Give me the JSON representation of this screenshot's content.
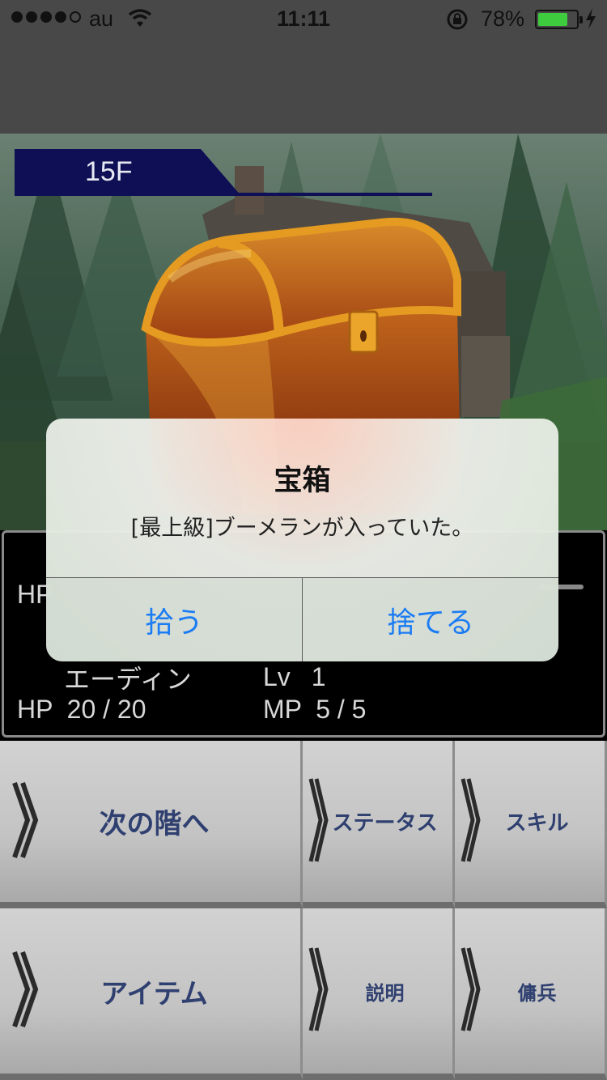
{
  "status_bar": {
    "carrier": "au",
    "time": "11:11",
    "battery_percent": "78%",
    "battery_level": 0.78,
    "signal_bars_filled": 4,
    "signal_bars_total": 5,
    "icons": [
      "wifi-icon",
      "rotation-lock-icon",
      "battery-icon",
      "charging-bolt-icon"
    ]
  },
  "scene": {
    "floor_label": "15F",
    "object_icon": "treasure-chest-icon"
  },
  "party": {
    "hp_label_partial": "HP",
    "hero": {
      "name": "エーディン",
      "level_label": "Lv",
      "level_value": "1",
      "hp_text": "HP  20 / 20",
      "mp_text": "MP  5 / 5"
    }
  },
  "commands": {
    "next_floor": "次の階へ",
    "status": "ステータス",
    "skill": "スキル",
    "item": "アイテム",
    "help": "説明",
    "mercenary": "傭兵"
  },
  "alert": {
    "title": "宝箱",
    "message": "[最上級]ブーメランが入っていた。",
    "pick_up": "拾う",
    "discard": "捨てる"
  },
  "colors": {
    "floor_banner": "#0e0f54",
    "alert_button_text": "#1b7cf4",
    "command_text": "#2f4070",
    "battery_fill": "#3ecb3e"
  }
}
